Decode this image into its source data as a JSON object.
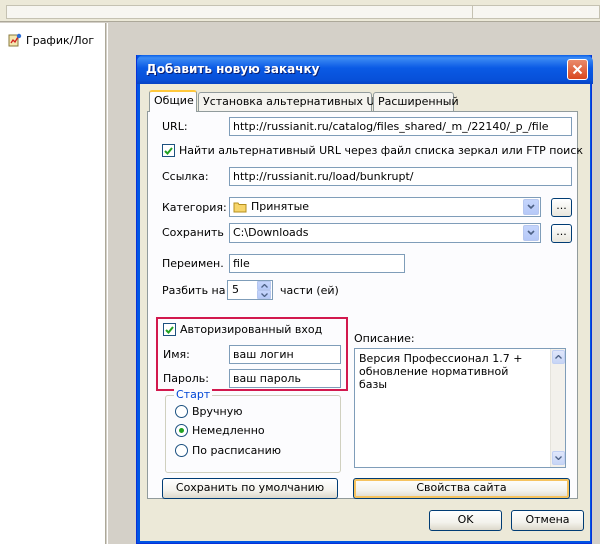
{
  "background": {
    "tree_item_label": "График/Лог"
  },
  "dialog": {
    "title": "Добавить новую закачку",
    "tabs": [
      {
        "label": "Общие",
        "active": true
      },
      {
        "label": "Установка альтернативных URL",
        "active": false
      },
      {
        "label": "Расширенный",
        "active": false
      }
    ],
    "url": {
      "label": "URL:",
      "value": "http://russianit.ru/catalog/files_shared/_m_/22140/_p_/file"
    },
    "find_alt_url": {
      "label": "Найти альтернативный URL через файл списка зеркал или FTP поиск",
      "checked": true
    },
    "referer": {
      "label": "Ссылка:",
      "value": "http://russianit.ru/load/bunkrupt/"
    },
    "category": {
      "label": "Категория:",
      "value": "Принятые",
      "browse": "..."
    },
    "save_to": {
      "label": "Сохранить",
      "value": "C:\\Downloads",
      "browse": "..."
    },
    "rename": {
      "label": "Переимен.",
      "value": "file"
    },
    "split": {
      "label": "Разбить на",
      "value": "5",
      "suffix": "части (ей)"
    },
    "auth": {
      "label": "Авторизированный вход",
      "checked": true,
      "name_label": "Имя:",
      "name_value": "ваш логин",
      "password_label": "Пароль:",
      "password_value": "ваш пароль"
    },
    "description": {
      "label": "Описание:",
      "value": "Версия Профессионал 1.7 + обновление нормативной базы"
    },
    "start": {
      "legend": "Старт",
      "options": [
        {
          "label": "Вручную",
          "selected": false
        },
        {
          "label": "Немедленно",
          "selected": true
        },
        {
          "label": "По расписанию",
          "selected": false
        }
      ]
    },
    "save_default_button": "Сохранить по умолчанию",
    "site_props_button": "Свойства сайта",
    "ok_button": "OK",
    "cancel_button": "Отмена"
  },
  "colors": {
    "title_blue": "#0054e3",
    "highlight_red": "#d2194e",
    "radio_green": "#21a121",
    "tab_accent": "#ffc83c"
  }
}
